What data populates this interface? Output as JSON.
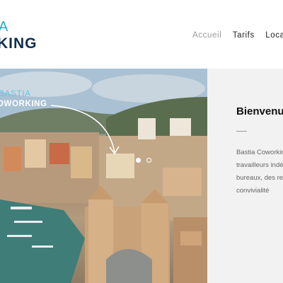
{
  "header": {
    "logo": {
      "top_text": "A",
      "bottom_text": "KING"
    },
    "nav": [
      {
        "label": "Accueil",
        "active": true
      },
      {
        "label": "Tarifs",
        "active": false
      },
      {
        "label": "Localis",
        "active": false
      }
    ]
  },
  "hero": {
    "overlay_top": "BASTIA",
    "overlay_bottom": "OWORKING",
    "slides": {
      "total": 2,
      "current": 1
    }
  },
  "intro": {
    "title": "Bienvenu",
    "lines": [
      "Bastia Coworkin",
      "travailleurs indé",
      "bureaux, des re",
      "convivialité"
    ]
  },
  "colors": {
    "brand_light": "#29a6d8",
    "brand_dark": "#0f2d4f",
    "nav_active": "#9a9a9a",
    "panel_bg": "#f2f2f2"
  }
}
